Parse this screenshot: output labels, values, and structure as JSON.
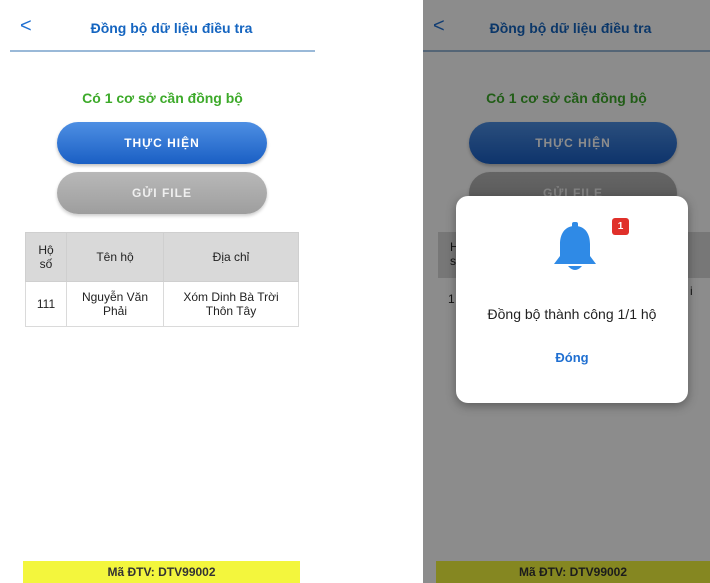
{
  "header": {
    "back_icon": "chevron-left-icon",
    "back_glyph": "<",
    "title": "Đồng bộ dữ liệu điều tra"
  },
  "status_text": "Có 1 cơ sở cần đồng bộ",
  "buttons": {
    "execute": "THỰC HIỆN",
    "send_file": "GỬI FILE"
  },
  "table": {
    "columns": [
      "Hộ số",
      "Tên hộ",
      "Địa chỉ"
    ],
    "rows": [
      [
        "111",
        "Nguyễn Văn Phải",
        "Xóm Dinh Bà Trời Thôn Tây"
      ]
    ]
  },
  "right_partial": {
    "col_fragment": "H\ns",
    "row_fragment_left": "1",
    "row_fragment_right": "i"
  },
  "footer": "Mã ĐTV: DTV99002",
  "dialog": {
    "icon": "bell-icon",
    "badge_count": "1",
    "message": "Đồng bộ thành công 1/1 hộ",
    "close_label": "Đóng"
  },
  "colors": {
    "accent": "#1565c0",
    "success": "#3daa2a",
    "footer": "#f3f63d",
    "badge": "#e0302a"
  }
}
